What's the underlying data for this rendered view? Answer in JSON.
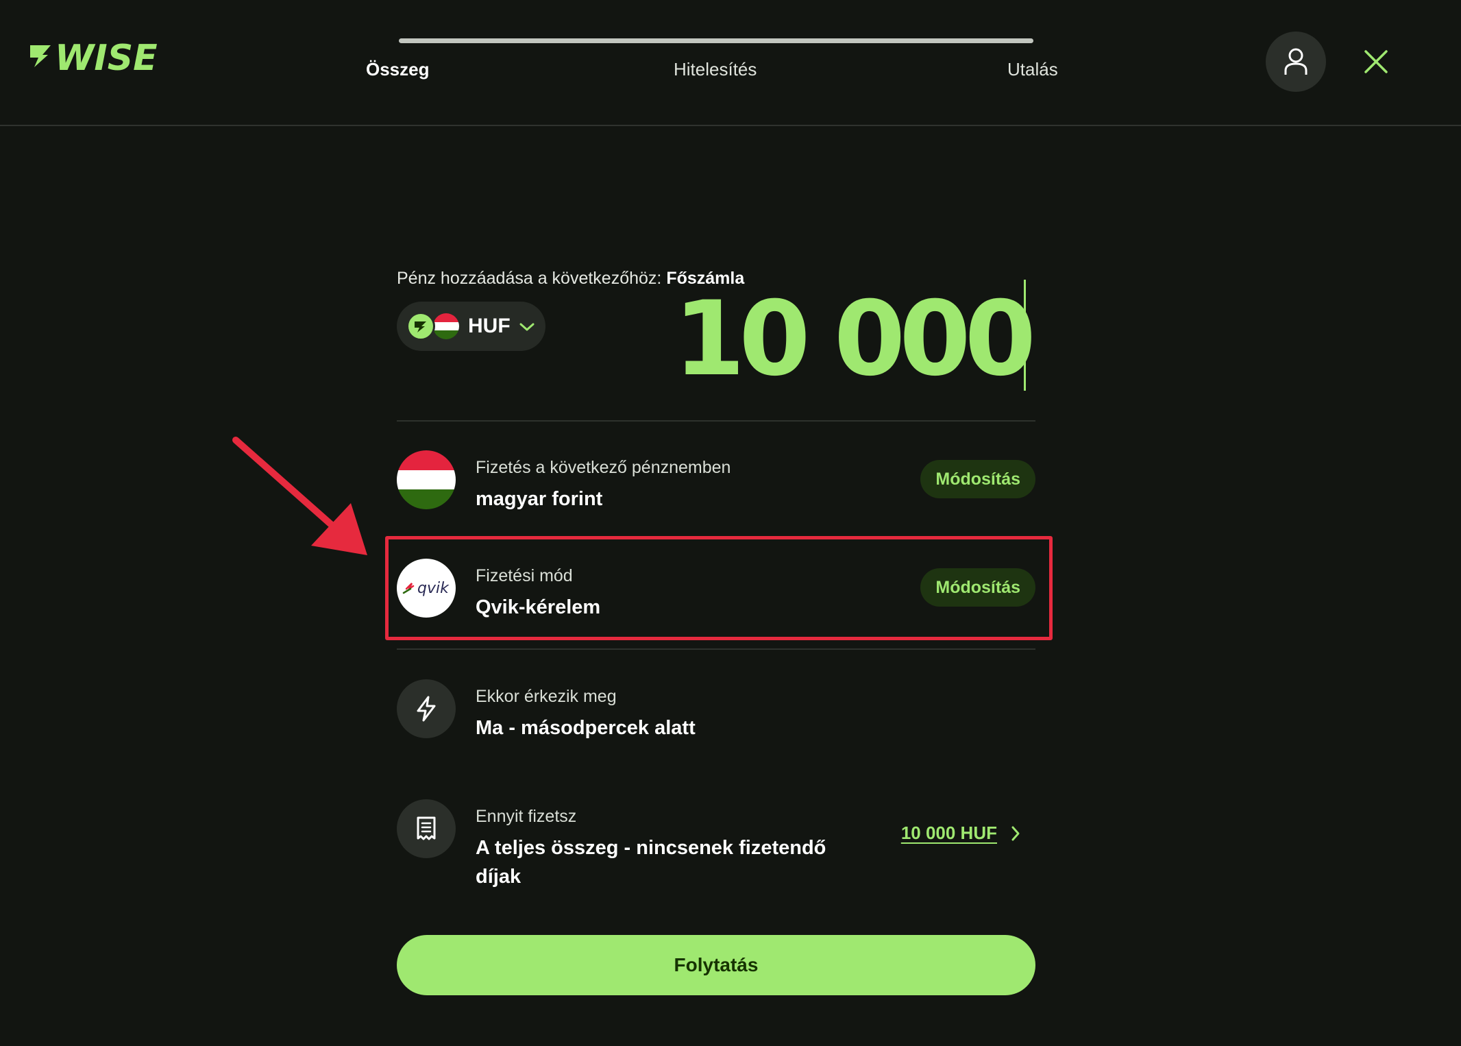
{
  "header": {
    "logo_text": "WISE",
    "steps": [
      "Összeg",
      "Hitelesítés",
      "Utalás"
    ],
    "active_step": 0
  },
  "add_money": {
    "label": "Pénz hozzáadása a következőhöz:",
    "account": "Főszámla"
  },
  "currency": {
    "code": "HUF"
  },
  "amount": "10 000",
  "rows": [
    {
      "label": "Fizetés a következő pénznemben",
      "value": "magyar forint",
      "action": "Módosítás"
    },
    {
      "label": "Fizetési mód",
      "value": "Qvik-kérelem",
      "action": "Módosítás",
      "logo_text": "qvik"
    },
    {
      "label": "Ekkor érkezik meg",
      "value": "Ma - másodpercek alatt"
    },
    {
      "label": "Ennyit fizetsz",
      "value": "A teljes összeg - nincsenek fizetendő díjak",
      "amount": "10 000 HUF"
    }
  ],
  "continue_label": "Folytatás",
  "colors": {
    "accent": "#9fe870",
    "background": "#121511",
    "annotation": "#e62a3e"
  }
}
